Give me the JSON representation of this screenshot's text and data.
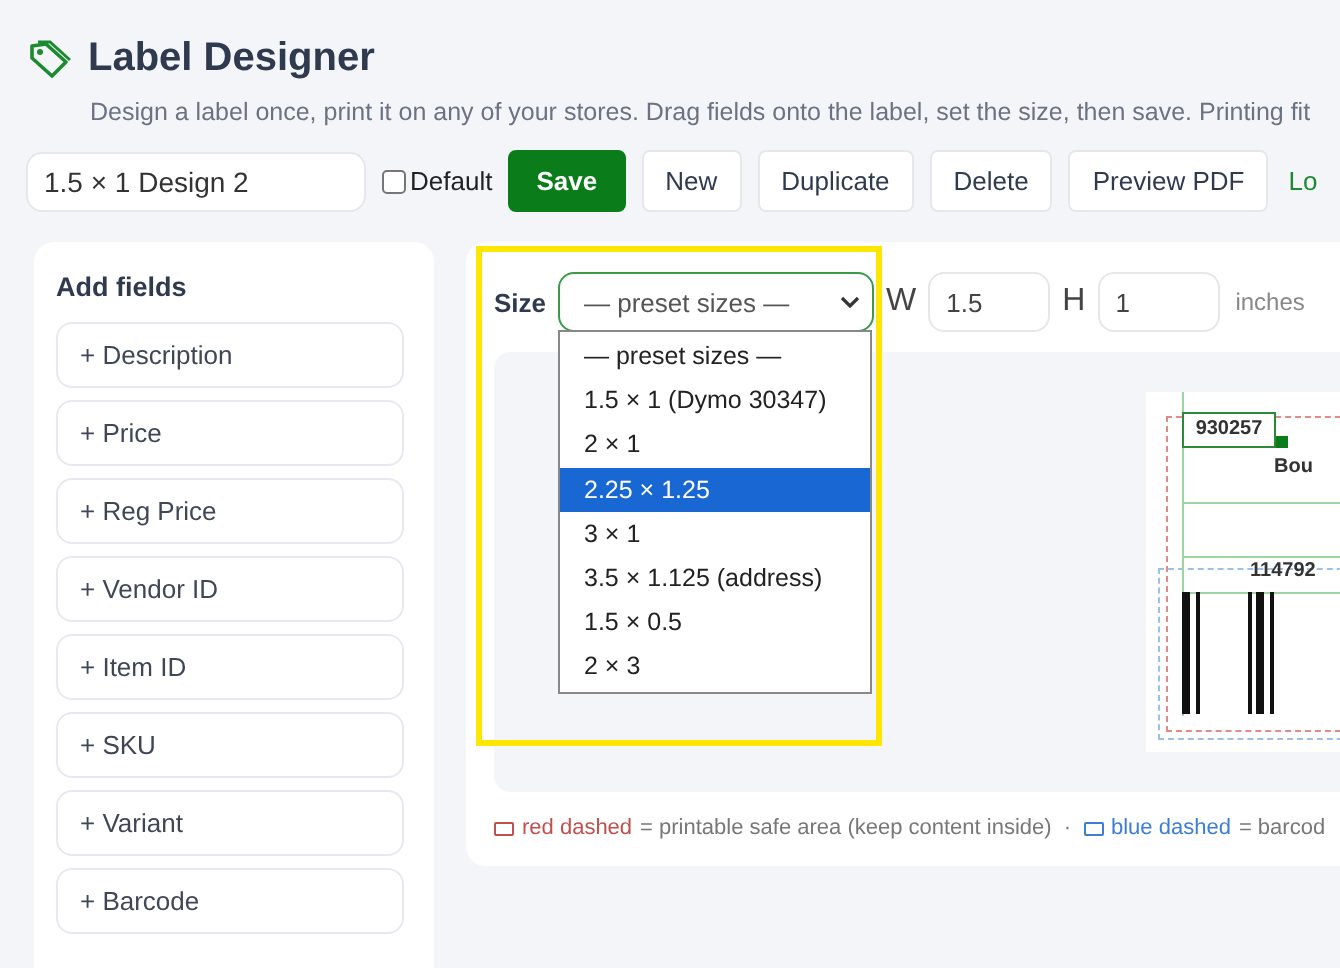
{
  "header": {
    "title": "Label Designer",
    "subtitle": "Design a label once, print it on any of your stores. Drag fields onto the label, set the size, then save. Printing fit"
  },
  "toolbar": {
    "design_name": "1.5 × 1 Design 2",
    "default": {
      "label": "Default",
      "checked": false
    },
    "buttons": [
      {
        "label": "Save",
        "kind": "primary"
      },
      {
        "label": "New",
        "kind": "plain"
      },
      {
        "label": "Duplicate",
        "kind": "plain"
      },
      {
        "label": "Delete",
        "kind": "plain"
      },
      {
        "label": "Preview PDF",
        "kind": "plain"
      }
    ],
    "link": "Lo"
  },
  "fields_panel": {
    "title": "Add fields",
    "items": [
      "+ Description",
      "+ Price",
      "+ Reg Price",
      "+ Vendor ID",
      "+ Item ID",
      "+ SKU",
      "+ Variant",
      "+ Barcode"
    ]
  },
  "size": {
    "label": "Size",
    "select_value": "— preset sizes —",
    "options": [
      {
        "label": "— preset sizes —",
        "selected": false
      },
      {
        "label": "1.5 × 1 (Dymo 30347)",
        "selected": false
      },
      {
        "label": "2 × 1",
        "selected": false
      },
      {
        "label": "2.25 × 1.25",
        "selected": true
      },
      {
        "label": "3 × 1",
        "selected": false
      },
      {
        "label": "3.5 × 1.125 (address)",
        "selected": false
      },
      {
        "label": "1.5 × 0.5",
        "selected": false
      },
      {
        "label": "2 × 3",
        "selected": false
      }
    ],
    "w_label": "W",
    "w_value": "1.5",
    "h_label": "H",
    "h_value": "1",
    "unit": "inches"
  },
  "preview": {
    "field_1": "930257",
    "field_2": "Bou",
    "field_3": "114792"
  },
  "legend": [
    {
      "label": "red dashed",
      "text": "= printable safe area (keep content inside)",
      "color": "#c0504d"
    },
    {
      "label": "blue dashed",
      "text": "= barcod",
      "color": "#3b7dd8"
    }
  ],
  "legend_separator": "·"
}
